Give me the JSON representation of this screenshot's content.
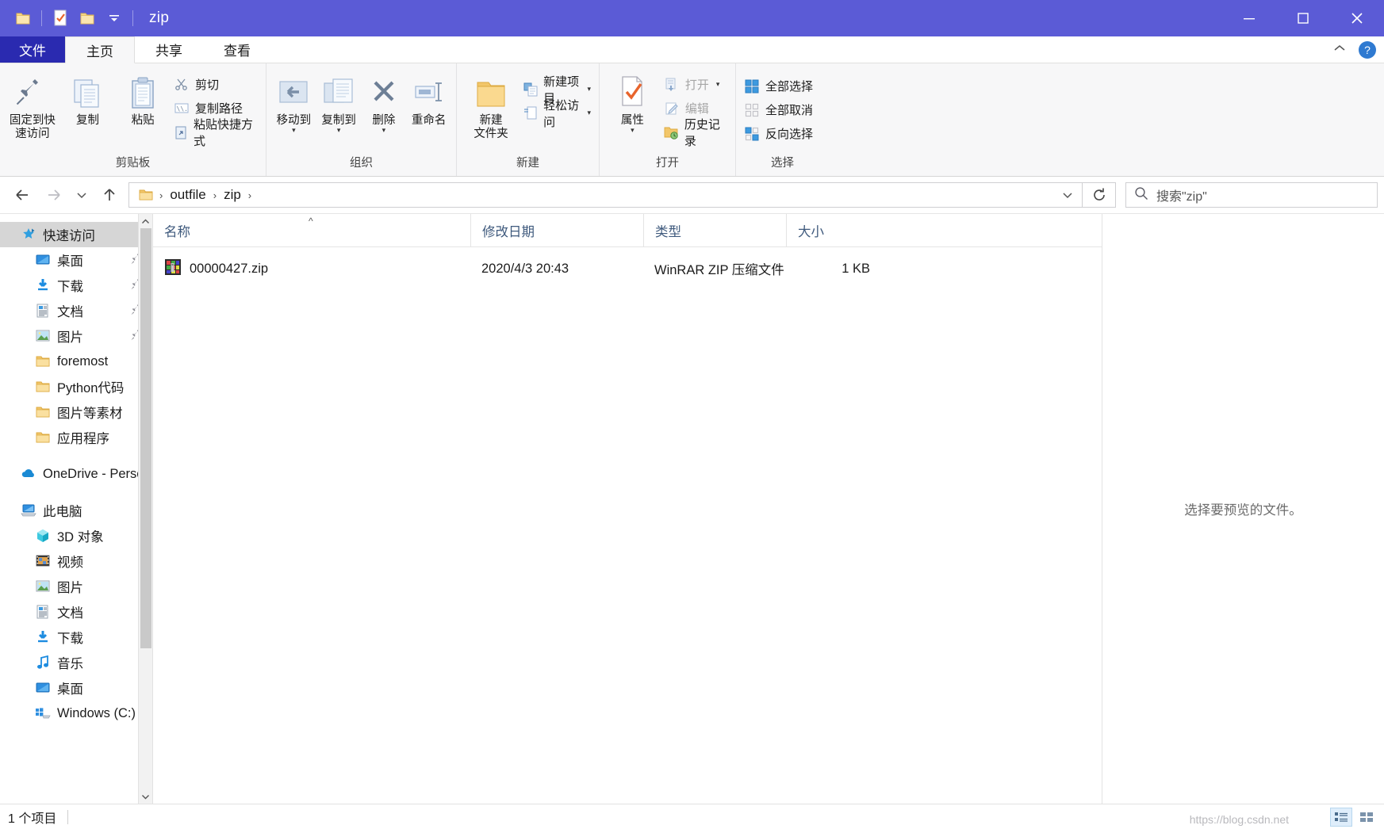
{
  "window": {
    "title": "zip",
    "quick_access_buttons": [
      "folder-icon",
      "properties-icon",
      "new-folder-icon"
    ],
    "dropdown_label": "▾",
    "caption": {
      "minimize": "minimize-icon",
      "maximize": "maximize-icon",
      "close": "close-icon"
    }
  },
  "ribbon": {
    "tabs": [
      {
        "label": "文件",
        "id": "file"
      },
      {
        "label": "主页",
        "id": "home"
      },
      {
        "label": "共享",
        "id": "share"
      },
      {
        "label": "查看",
        "id": "view"
      }
    ],
    "active_tab": "主页",
    "collapse_label": "^",
    "help_label": "?",
    "groups": [
      {
        "name": "剪贴板",
        "big_buttons": [
          {
            "label": "固定到快\n速访问",
            "icon": "pin-icon"
          },
          {
            "label": "复制",
            "icon": "copy-icon"
          },
          {
            "label": "粘贴",
            "icon": "paste-icon"
          }
        ],
        "small_buttons": [
          {
            "label": "剪切",
            "icon": "scissors-icon"
          },
          {
            "label": "复制路径",
            "icon": "copy-path-icon"
          },
          {
            "label": "粘贴快捷方式",
            "icon": "paste-shortcut-icon"
          }
        ]
      },
      {
        "name": "组织",
        "big_buttons": [
          {
            "label": "移动到",
            "icon": "move-to-icon",
            "has_caret": true
          },
          {
            "label": "复制到",
            "icon": "copy-to-icon",
            "has_caret": true
          },
          {
            "label": "删除",
            "icon": "delete-icon",
            "has_caret": true
          },
          {
            "label": "重命名",
            "icon": "rename-icon"
          }
        ],
        "small_buttons": []
      },
      {
        "name": "新建",
        "big_buttons": [
          {
            "label": "新建\n文件夹",
            "icon": "new-folder-icon"
          }
        ],
        "small_buttons": [
          {
            "label": "新建项目",
            "icon": "new-item-icon",
            "has_caret": true
          },
          {
            "label": "轻松访问",
            "icon": "easy-access-icon",
            "has_caret": true
          }
        ]
      },
      {
        "name": "打开",
        "big_buttons": [
          {
            "label": "属性",
            "icon": "properties-icon",
            "has_caret": true
          }
        ],
        "small_buttons": [
          {
            "label": "打开",
            "icon": "open-icon",
            "has_caret": true,
            "dim": true
          },
          {
            "label": "编辑",
            "icon": "edit-icon",
            "dim": true
          },
          {
            "label": "历史记录",
            "icon": "history-icon"
          }
        ]
      },
      {
        "name": "选择",
        "big_buttons": [],
        "small_buttons": [
          {
            "label": "全部选择",
            "icon": "select-all-icon"
          },
          {
            "label": "全部取消",
            "icon": "select-none-icon"
          },
          {
            "label": "反向选择",
            "icon": "invert-selection-icon"
          }
        ]
      }
    ]
  },
  "address_bar": {
    "back_icon": "arrow-left-icon",
    "forward_icon": "arrow-right-icon",
    "recent_icon": "chevron-down-icon",
    "up_icon": "arrow-up-icon",
    "breadcrumbs": [
      "outfile",
      "zip"
    ],
    "separator": "›",
    "dropdown_icon": "chevron-down-icon",
    "refresh_icon": "refresh-icon"
  },
  "search": {
    "placeholder": "搜索\"zip\"",
    "icon": "search-icon"
  },
  "sidebar": {
    "items": [
      {
        "label": "快速访问",
        "icon": "star-pin-icon",
        "level": 0,
        "selected": true,
        "pinned": false
      },
      {
        "label": "桌面",
        "icon": "desktop-icon",
        "level": 1,
        "selected": false,
        "pinned": true
      },
      {
        "label": "下载",
        "icon": "download-icon",
        "level": 1,
        "selected": false,
        "pinned": true
      },
      {
        "label": "文档",
        "icon": "documents-icon",
        "level": 1,
        "selected": false,
        "pinned": true
      },
      {
        "label": "图片",
        "icon": "pictures-icon",
        "level": 1,
        "selected": false,
        "pinned": true
      },
      {
        "label": "foremost",
        "icon": "folder-icon",
        "level": 1,
        "selected": false,
        "pinned": false
      },
      {
        "label": "Python代码",
        "icon": "folder-icon",
        "level": 1,
        "selected": false,
        "pinned": false
      },
      {
        "label": "图片等素材",
        "icon": "folder-icon",
        "level": 1,
        "selected": false,
        "pinned": false
      },
      {
        "label": "应用程序",
        "icon": "folder-icon",
        "level": 1,
        "selected": false,
        "pinned": false
      },
      {
        "label": "GAP",
        "icon": "gap",
        "level": 0,
        "selected": false,
        "pinned": false
      },
      {
        "label": "OneDrive - Persc",
        "icon": "onedrive-icon",
        "level": 0,
        "selected": false,
        "pinned": false
      },
      {
        "label": "GAP",
        "icon": "gap",
        "level": 0,
        "selected": false,
        "pinned": false
      },
      {
        "label": "此电脑",
        "icon": "this-pc-icon",
        "level": 0,
        "selected": false,
        "pinned": false
      },
      {
        "label": "3D 对象",
        "icon": "3d-objects-icon",
        "level": 1,
        "selected": false,
        "pinned": false
      },
      {
        "label": "视频",
        "icon": "videos-icon",
        "level": 1,
        "selected": false,
        "pinned": false
      },
      {
        "label": "图片",
        "icon": "pictures-icon",
        "level": 1,
        "selected": false,
        "pinned": false
      },
      {
        "label": "文档",
        "icon": "documents-icon",
        "level": 1,
        "selected": false,
        "pinned": false
      },
      {
        "label": "下载",
        "icon": "download-icon",
        "level": 1,
        "selected": false,
        "pinned": false
      },
      {
        "label": "音乐",
        "icon": "music-icon",
        "level": 1,
        "selected": false,
        "pinned": false
      },
      {
        "label": "桌面",
        "icon": "desktop-icon",
        "level": 1,
        "selected": false,
        "pinned": false
      },
      {
        "label": "Windows (C:)",
        "icon": "drive-windows-icon",
        "level": 1,
        "selected": false,
        "pinned": false
      }
    ]
  },
  "file_list": {
    "columns": [
      {
        "label": "名称",
        "key": "name",
        "sorted": true,
        "sort_dir": "asc"
      },
      {
        "label": "修改日期",
        "key": "date",
        "sorted": false
      },
      {
        "label": "类型",
        "key": "type",
        "sorted": false
      },
      {
        "label": "大小",
        "key": "size",
        "sorted": false
      }
    ],
    "rows": [
      {
        "name": "00000427.zip",
        "date": "2020/4/3 20:43",
        "type": "WinRAR ZIP 压缩文件",
        "size": "1 KB",
        "icon": "winrar-zip-icon"
      }
    ]
  },
  "preview": {
    "message": "选择要预览的文件。"
  },
  "status": {
    "item_count": "1 个项目",
    "watermark": "https://blog.csdn.net",
    "view_buttons": [
      {
        "icon": "details-view-icon",
        "active": true
      },
      {
        "icon": "large-icons-view-icon",
        "active": false
      }
    ]
  },
  "colors": {
    "titlebar": "#5b5bd6",
    "file_tab": "#2a2ab0",
    "ribbon_bg": "#f7f7f8",
    "selection": "#d6d6d6",
    "column_header_text": "#3f5a7d",
    "accent_blue": "#2f7ad1"
  }
}
